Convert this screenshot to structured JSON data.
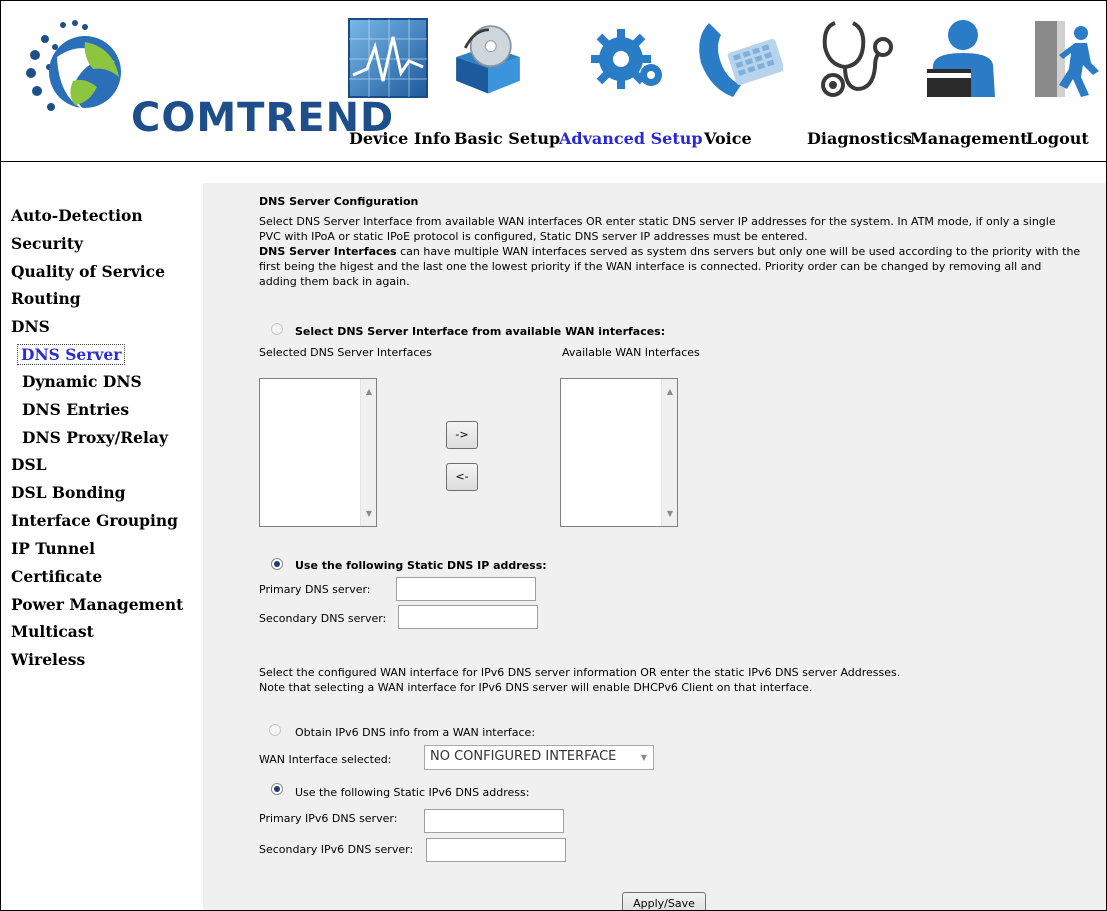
{
  "brand": {
    "name": "COMTREND"
  },
  "nav": {
    "items": [
      {
        "label": "Device Info",
        "icon": "device-info-monitor-icon",
        "active": false
      },
      {
        "label": "Basic Setup",
        "icon": "basic-setup-disc-box-icon",
        "active": false
      },
      {
        "label": "Advanced Setup",
        "icon": "advanced-setup-gears-icon",
        "active": true
      },
      {
        "label": "Voice",
        "icon": "voice-phone-icon",
        "active": false
      },
      {
        "label": "Diagnostics",
        "icon": "diagnostics-stethoscope-icon",
        "active": false
      },
      {
        "label": "Management",
        "icon": "management-person-icon",
        "active": false
      },
      {
        "label": "Logout",
        "icon": "logout-exit-icon",
        "active": false
      }
    ]
  },
  "sidebar": {
    "items": [
      {
        "label": "Auto-Detection"
      },
      {
        "label": "Security"
      },
      {
        "label": "Quality of Service"
      },
      {
        "label": "Routing"
      },
      {
        "label": "DNS"
      },
      {
        "label": "DNS Server",
        "selected": true
      },
      {
        "label": "Dynamic DNS"
      },
      {
        "label": "DNS Entries"
      },
      {
        "label": "DNS Proxy/Relay"
      },
      {
        "label": "DSL"
      },
      {
        "label": "DSL Bonding"
      },
      {
        "label": "Interface Grouping"
      },
      {
        "label": "IP Tunnel"
      },
      {
        "label": "Certificate"
      },
      {
        "label": "Power Management"
      },
      {
        "label": "Multicast"
      },
      {
        "label": "Wireless"
      }
    ]
  },
  "main": {
    "title": "DNS Server Configuration",
    "intro_line1": "Select DNS Server Interface from available WAN interfaces OR enter static DNS server IP addresses for the system. In ATM mode, if only a single",
    "intro_line2": "PVC with IPoA or static IPoE protocol is configured, Static DNS server IP addresses must be entered.",
    "intro_bold": "DNS Server Interfaces",
    "intro_line3_rest": " can have multiple WAN interfaces served as system dns servers but only one will be used according to the priority with the",
    "intro_line4": "first being the higest and the last one the lowest priority if the WAN interface is connected. Priority order can be changed by removing all and",
    "intro_line5": "adding them back in again.",
    "wan_radio_label": "Select DNS Server Interface from available WAN interfaces:",
    "selected_list_label": "Selected DNS Server Interfaces",
    "available_list_label": "Available WAN Interfaces",
    "move_right_label": "->",
    "move_left_label": "<-",
    "static_radio_label": "Use the following Static DNS IP address:",
    "primary_dns_label": "Primary DNS server:",
    "secondary_dns_label": "Secondary DNS server:",
    "primary_dns_value": "",
    "secondary_dns_value": "",
    "ipv6_intro_line1": "Select the configured WAN interface for IPv6 DNS server information OR enter the static IPv6 DNS server Addresses.",
    "ipv6_intro_line2": "Note that selecting a WAN interface for IPv6 DNS server will enable DHCPv6 Client on that interface.",
    "ipv6_wan_radio_label": "Obtain IPv6 DNS info from a WAN interface:",
    "wan_interface_selected_label": "WAN Interface selected:",
    "wan_interface_selected_value": "NO CONFIGURED INTERFACE",
    "ipv6_static_radio_label": "Use the following Static IPv6 DNS address:",
    "primary_ipv6_label": "Primary IPv6 DNS server:",
    "secondary_ipv6_label": "Secondary IPv6 DNS server:",
    "primary_ipv6_value": "",
    "secondary_ipv6_value": "",
    "apply_label": "Apply/Save"
  },
  "colors": {
    "active_nav": "#2828d6",
    "brand_blue": "#1e4f8a",
    "content_bg": "#f0f0f0"
  }
}
